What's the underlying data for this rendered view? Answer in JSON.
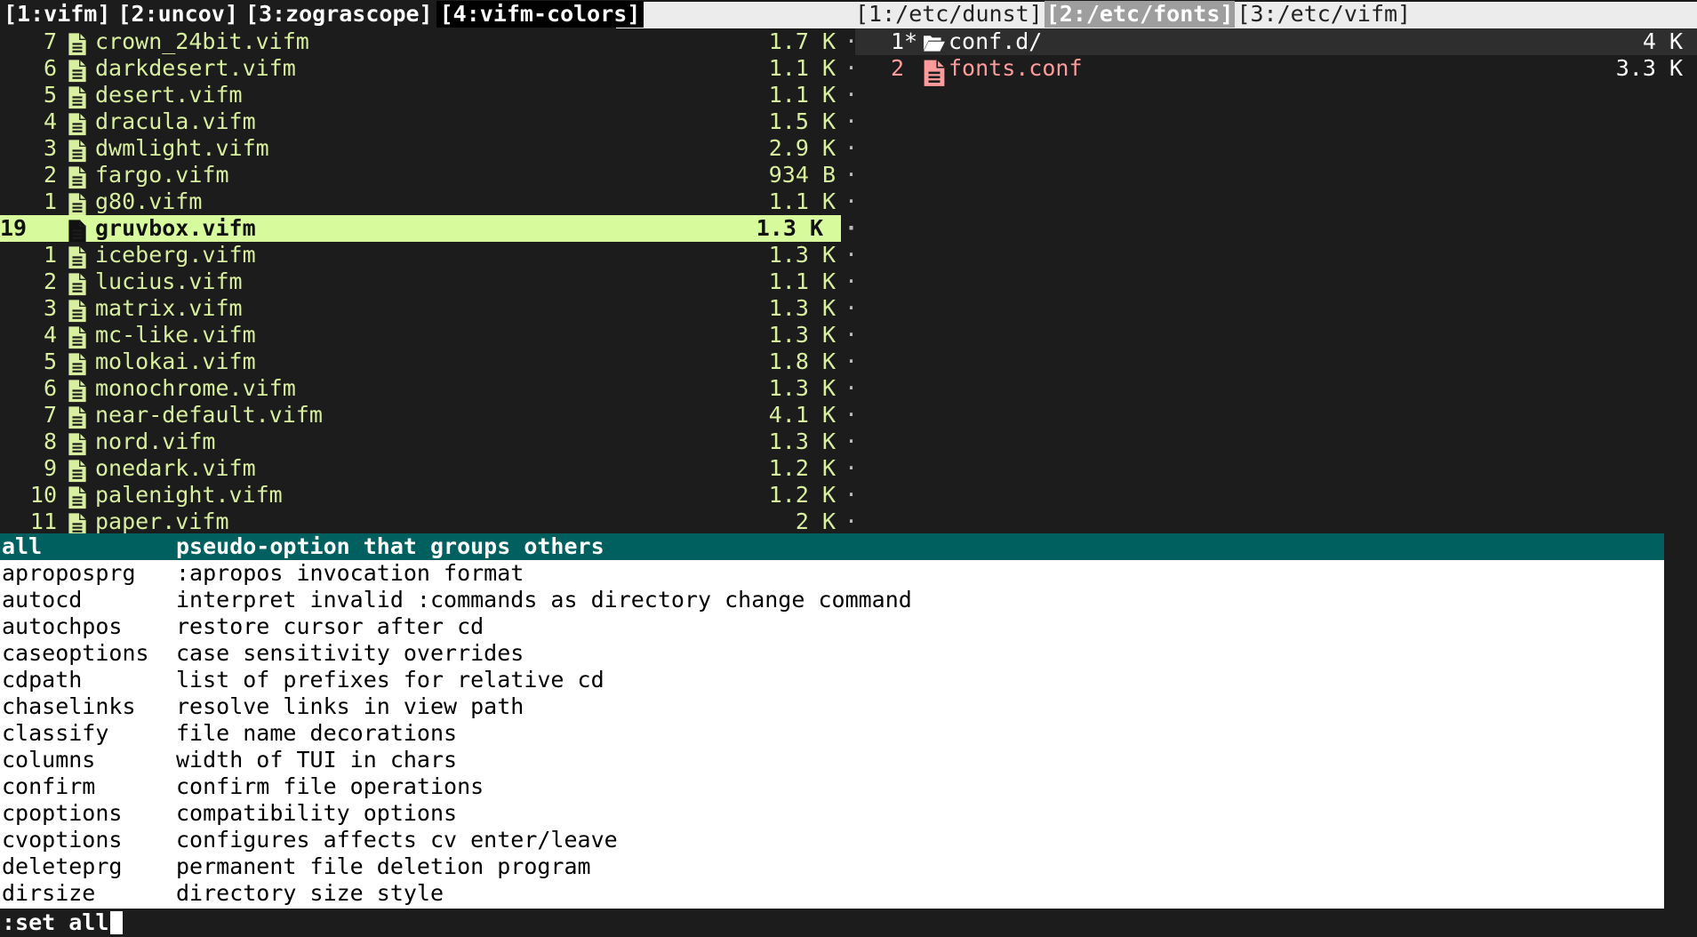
{
  "tabs_left": [
    {
      "label": "[1:vifm]",
      "active": false
    },
    {
      "label": "[2:uncov]",
      "active": false
    },
    {
      "label": "[3:zograscope]",
      "active": false
    },
    {
      "label": "[4:vifm-colors]",
      "active": true
    }
  ],
  "tabs_right": [
    {
      "label": "[1:/etc/dunst]",
      "active": false
    },
    {
      "label": "[2:/etc/fonts]",
      "active": true
    },
    {
      "label": "[3:/etc/vifm]",
      "active": false
    }
  ],
  "left_pane": {
    "files": [
      {
        "num": "7",
        "name": "crown_24bit.vifm",
        "size": "1.7 K"
      },
      {
        "num": "6",
        "name": "darkdesert.vifm",
        "size": "1.1 K"
      },
      {
        "num": "5",
        "name": "desert.vifm",
        "size": "1.1 K"
      },
      {
        "num": "4",
        "name": "dracula.vifm",
        "size": "1.5 K"
      },
      {
        "num": "3",
        "name": "dwmlight.vifm",
        "size": "2.9 K"
      },
      {
        "num": "2",
        "name": "fargo.vifm",
        "size": "934 B"
      },
      {
        "num": "1",
        "name": "g80.vifm",
        "size": "1.1 K"
      },
      {
        "num": "19",
        "name": "gruvbox.vifm",
        "size": "1.3 K",
        "current": true
      },
      {
        "num": "1",
        "name": "iceberg.vifm",
        "size": "1.3 K"
      },
      {
        "num": "2",
        "name": "lucius.vifm",
        "size": "1.1 K"
      },
      {
        "num": "3",
        "name": "matrix.vifm",
        "size": "1.3 K"
      },
      {
        "num": "4",
        "name": "mc-like.vifm",
        "size": "1.3 K"
      },
      {
        "num": "5",
        "name": "molokai.vifm",
        "size": "1.8 K"
      },
      {
        "num": "6",
        "name": "monochrome.vifm",
        "size": "1.3 K"
      },
      {
        "num": "7",
        "name": "near-default.vifm",
        "size": "4.1 K"
      },
      {
        "num": "8",
        "name": "nord.vifm",
        "size": "1.3 K"
      },
      {
        "num": "9",
        "name": "onedark.vifm",
        "size": "1.2 K"
      },
      {
        "num": "10",
        "name": "palenight.vifm",
        "size": "1.2 K"
      },
      {
        "num": "11",
        "name": "paper.vifm",
        "size": "2 K"
      }
    ],
    "separator_glyph": "·"
  },
  "right_pane": {
    "files": [
      {
        "num": "1*",
        "name": "conf.d/",
        "size": "4 K",
        "type": "dir",
        "current": true
      },
      {
        "num": "2",
        "name": "fonts.conf",
        "size": "3.3 K",
        "type": "conf",
        "current": false
      }
    ]
  },
  "menu": {
    "items": [
      {
        "name": "all",
        "desc": "pseudo-option that groups others",
        "selected": true
      },
      {
        "name": "aproposprg",
        "desc": ":apropos invocation format"
      },
      {
        "name": "autocd",
        "desc": "interpret invalid :commands as directory change command"
      },
      {
        "name": "autochpos",
        "desc": "restore cursor after cd"
      },
      {
        "name": "caseoptions",
        "desc": "case sensitivity overrides"
      },
      {
        "name": "cdpath",
        "desc": "list of prefixes for relative cd"
      },
      {
        "name": "chaselinks",
        "desc": "resolve links in view path"
      },
      {
        "name": "classify",
        "desc": "file name decorations"
      },
      {
        "name": "columns",
        "desc": "width of TUI in chars"
      },
      {
        "name": "confirm",
        "desc": "confirm file operations"
      },
      {
        "name": "cpoptions",
        "desc": "compatibility options"
      },
      {
        "name": "cvoptions",
        "desc": "configures affects cv enter/leave"
      },
      {
        "name": "deleteprg",
        "desc": "permanent file deletion program"
      },
      {
        "name": "dirsize",
        "desc": "directory size style"
      }
    ]
  },
  "cmdline": {
    "text": ":set all"
  },
  "colors": {
    "file_fg": "#d7ef9e",
    "current_bg": "#d7fa9d",
    "menu_selected_bg": "#005f5f",
    "conf_fg": "#ff9b9b",
    "background": "#1c1c1c"
  },
  "icons": {
    "file": "file-icon",
    "folder": "folder-open-icon",
    "conf": "config-file-icon"
  }
}
